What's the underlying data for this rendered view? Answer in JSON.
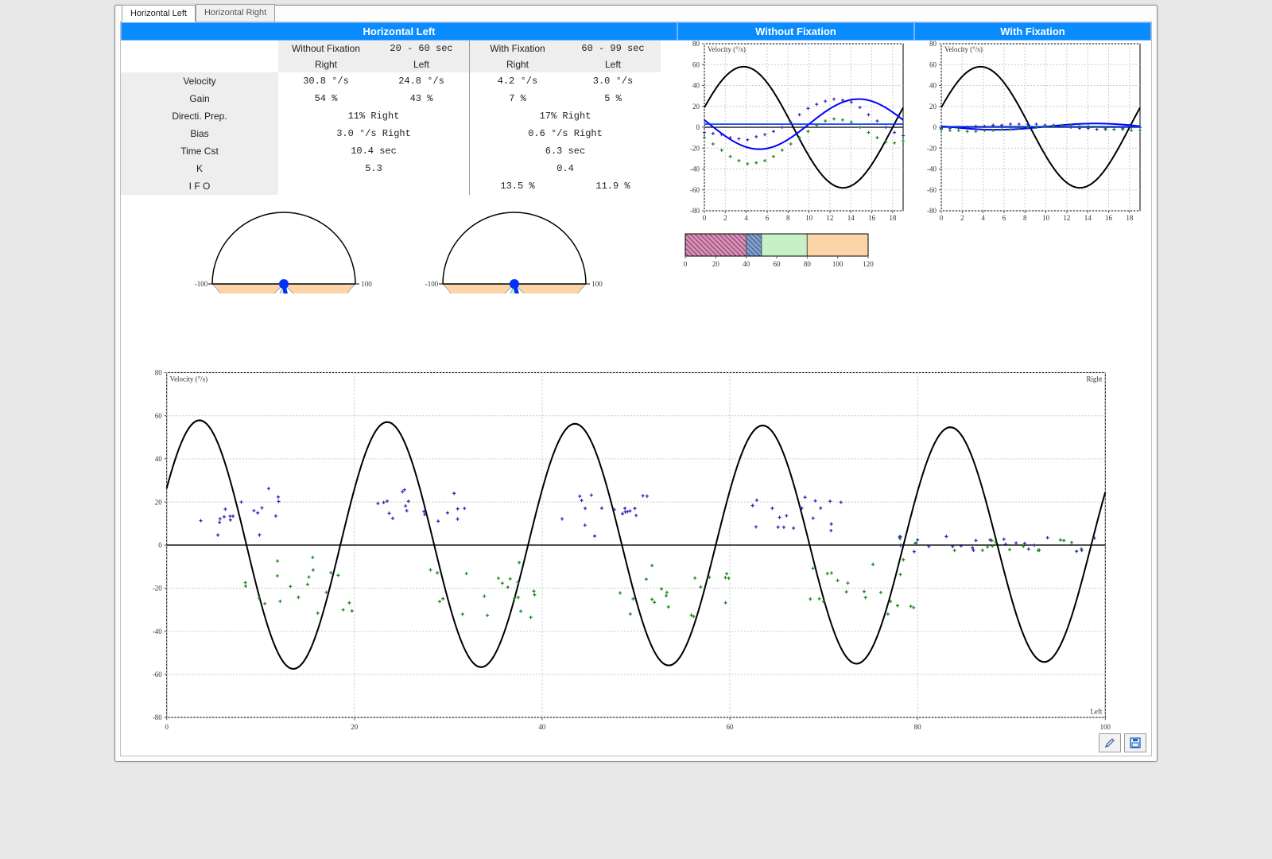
{
  "tabs": {
    "left": "Horizontal Left",
    "right": "Horizontal Right"
  },
  "title": "Horizontal Left",
  "h": {
    "withoutFixation": "Without Fixation",
    "wfRange": "20 -  60 sec",
    "withFixation": "With Fixation",
    "fRange": "60 -  99 sec",
    "right": "Right",
    "left": "Left"
  },
  "rows": {
    "velocity": "Velocity",
    "gain": "Gain",
    "dp": "Directi. Prep.",
    "bias": "Bias",
    "tc": "Time Cst",
    "k": "K",
    "ifo": "I F O"
  },
  "vals": {
    "velR1": "30.8 °/s",
    "velL1": "24.8 °/s",
    "velR2": "4.2 °/s",
    "velL2": "3.0 °/s",
    "gainR1": "54 %",
    "gainL1": "43 %",
    "gainR2": "7 %",
    "gainL2": "5 %",
    "dp1": "11% Right",
    "dp2": "17% Right",
    "bias1": "3.0 °/s Right",
    "bias2": "0.6 °/s Right",
    "tc1": "10.4 sec",
    "tc2": "6.3 sec",
    "k1": "5.3",
    "k2": "0.4",
    "ifoR2": "13.5 %",
    "ifoL2": "11.9 %"
  },
  "mini": {
    "without": "Without Fixation",
    "with": "With Fixation",
    "ylabel": "Velocity (°/s)"
  },
  "colors": {
    "green": "#c6f0c6",
    "orange": "#fbd5a8",
    "pink1": "#d890b8",
    "pink2": "#6ca8d8",
    "blue": "#0030ff"
  },
  "big": {
    "ylabel": "Velocity (°/s)",
    "right": "Right",
    "left": "Left"
  },
  "chart_data": {
    "gauges": [
      {
        "dp_deg": 11,
        "scale": [
          -100,
          -75,
          -50,
          -25,
          0,
          25,
          50,
          75,
          100
        ]
      },
      {
        "dp_deg": 17,
        "scale": [
          -100,
          -75,
          -50,
          -25,
          0,
          25,
          50,
          75,
          100
        ]
      }
    ],
    "colorbar": {
      "ticks": [
        0,
        20,
        40,
        60,
        80,
        100,
        120
      ]
    },
    "mini_without": {
      "type": "line+scatter",
      "xrange": [
        0,
        19
      ],
      "yrange": [
        -80,
        80
      ],
      "ylabel": "Velocity (°/s)",
      "stimulus": {
        "amp": 58,
        "period": 19,
        "phase": -1
      },
      "fit": {
        "amp": 24,
        "period": 19,
        "phase": -9,
        "offset": 3
      },
      "scatter_pos_y": [
        -5,
        -6,
        -7,
        -10,
        -11,
        -12,
        -9,
        -7,
        -4,
        0,
        5,
        12,
        18,
        22,
        25,
        27,
        26,
        24,
        19,
        12,
        6,
        0,
        -5,
        -8
      ],
      "scatter_neg_y": [
        -10,
        -16,
        -22,
        -28,
        -32,
        -35,
        -34,
        -32,
        -28,
        -22,
        -16,
        -10,
        -4,
        2,
        6,
        8,
        7,
        5,
        0,
        -5,
        -10,
        -14,
        -15,
        -13
      ]
    },
    "mini_with": {
      "type": "line+scatter",
      "xrange": [
        0,
        19
      ],
      "yrange": [
        -80,
        80
      ],
      "ylabel": "Velocity (°/s)",
      "stimulus": {
        "amp": 58,
        "period": 19,
        "phase": -1
      },
      "fit": {
        "amp": 3,
        "period": 19,
        "phase": -9,
        "offset": 0.6
      },
      "scatter_pos_y": [
        -1,
        -1,
        0,
        0,
        1,
        1,
        2,
        2,
        3,
        3,
        3,
        3,
        2,
        2,
        1,
        0,
        -1,
        -1,
        -2,
        -2,
        -2,
        -1,
        0,
        0
      ],
      "scatter_neg_y": [
        -2,
        -3,
        -3,
        -4,
        -4,
        -3,
        -3,
        -2,
        -2,
        -1,
        0,
        0,
        1,
        1,
        2,
        2,
        1,
        1,
        0,
        -1,
        -2,
        -2,
        -3,
        -3
      ]
    },
    "big": {
      "type": "line+scatter",
      "xrange": [
        0,
        100
      ],
      "yrange": [
        -80,
        80
      ],
      "ylabel": "Velocity (°/s)",
      "stimulus": {
        "amp": 58,
        "period": 20,
        "phase": -1.5,
        "decay_to": 54
      },
      "scatter_pos": {
        "y_range": [
          8,
          28
        ],
        "x_range": [
          0,
          65
        ]
      },
      "scatter_neg": {
        "y_range": [
          -35,
          -5
        ],
        "x_range": [
          5,
          75
        ],
        "fixation_y": [
          -5,
          5
        ],
        "fixation_x": [
          78,
          100
        ]
      }
    }
  }
}
